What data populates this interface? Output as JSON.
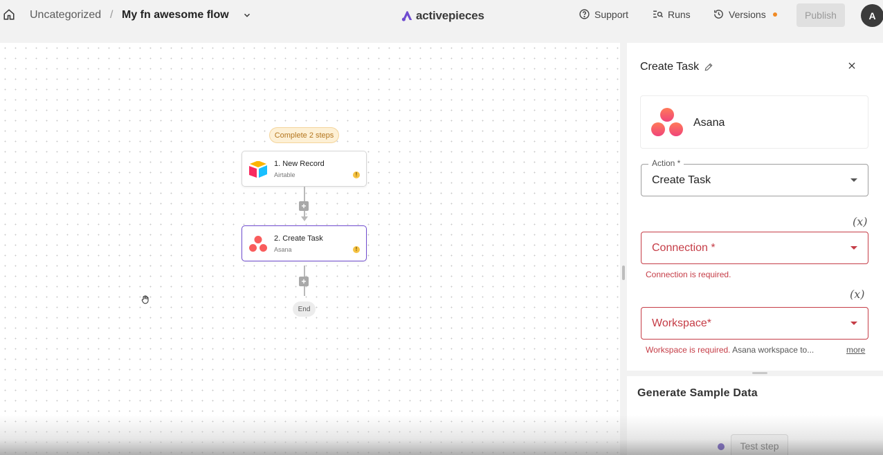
{
  "header": {
    "home_icon": "home-icon",
    "folder": "Uncategorized",
    "separator": "/",
    "flow_name": "My fn awesome flow",
    "logo_text": "activepieces",
    "support_label": "Support",
    "runs_label": "Runs",
    "versions_label": "Versions",
    "publish_label": "Publish",
    "avatar_initial": "A",
    "colors": {
      "brand": "#6f4cd0",
      "versions_dot": "#f08a24"
    }
  },
  "canvas": {
    "steps_badge": "Complete 2 steps",
    "steps": [
      {
        "title": "1. New Record",
        "subtitle": "Airtable",
        "icon": "airtable-icon",
        "warning": "!"
      },
      {
        "title": "2. Create Task",
        "subtitle": "Asana",
        "icon": "asana-icon",
        "warning": "!"
      }
    ],
    "add_symbol": "+",
    "end_label": "End"
  },
  "panel": {
    "title": "Create Task",
    "piece_name": "Asana",
    "action_label": "Action *",
    "action_value": "Create Task",
    "fx_symbol": "(x)",
    "connection_placeholder": "Connection *",
    "connection_error": "Connection is required.",
    "workspace_placeholder": "Workspace*",
    "workspace_error": "Workspace is required.",
    "workspace_hint": " Asana workspace to...",
    "more_link": "more",
    "error_color": "#c53c46"
  },
  "sample": {
    "title": "Generate Sample Data",
    "test_button": "Test step"
  }
}
